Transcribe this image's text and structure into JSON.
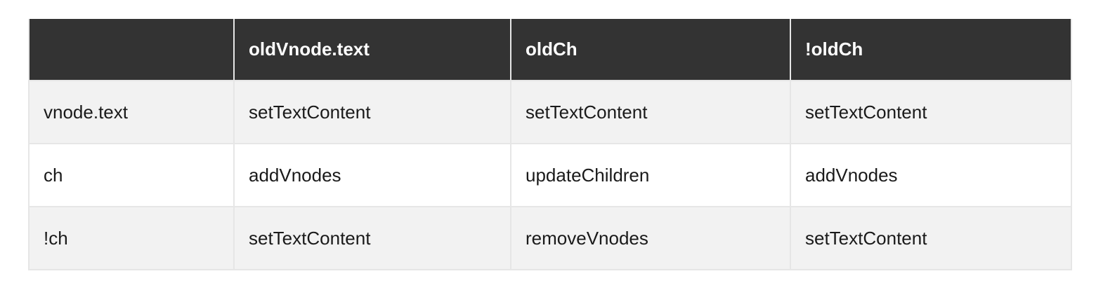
{
  "table": {
    "headers": [
      "",
      "oldVnode.text",
      "oldCh",
      "!oldCh"
    ],
    "rows": [
      [
        "vnode.text",
        "setTextContent",
        "setTextContent",
        "setTextContent"
      ],
      [
        "ch",
        "addVnodes",
        "updateChildren",
        "addVnodes"
      ],
      [
        "!ch",
        "setTextContent",
        "removeVnodes",
        "setTextContent"
      ]
    ]
  },
  "colors": {
    "header_bg": "#333333",
    "header_text": "#ffffff",
    "row_alt_bg": "#f2f2f2",
    "border": "#e6e6e6"
  }
}
